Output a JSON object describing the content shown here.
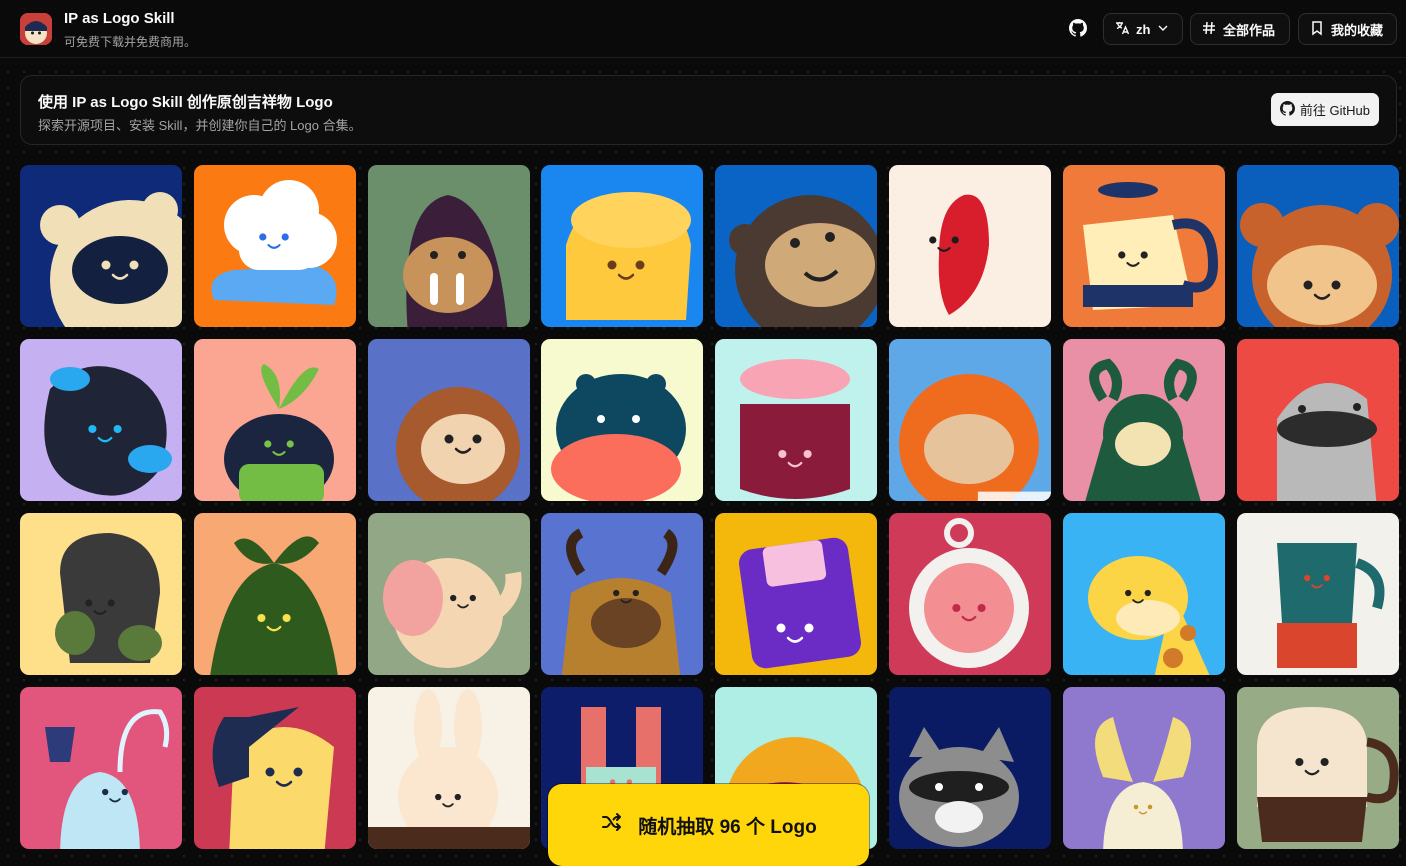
{
  "header": {
    "title": "IP as Logo Skill",
    "subtitle": "可免费下载并免费商用。",
    "language": "zh",
    "all_works": "全部作品",
    "favorites": "我的收藏"
  },
  "banner": {
    "title": "使用 IP as Logo Skill 创作原创吉祥物 Logo",
    "subtitle": "探索开源项目、安装 Skill，并创建你自己的 Logo 合集。",
    "github_button": "前往 GitHub"
  },
  "random_button": "随机抽取 96 个 Logo",
  "colors": {
    "accent": "#ffd60a",
    "background": "#0a0a0a"
  },
  "tiles": [
    {
      "bg": "#0f2a78",
      "fg": "#f1dfb7",
      "kind": "bear-mask"
    },
    {
      "bg": "#fb7b12",
      "fg": "#ffffff",
      "kind": "cloud"
    },
    {
      "bg": "#6a8f6a",
      "fg": "#3b1e3a",
      "kind": "walrus"
    },
    {
      "bg": "#1a87f1",
      "fg": "#ffc93e",
      "kind": "mooncake"
    },
    {
      "bg": "#0a64c6",
      "fg": "#4a3a31",
      "kind": "monkey"
    },
    {
      "bg": "#fbeee2",
      "fg": "#d81e2c",
      "kind": "pin"
    },
    {
      "bg": "#f07a3a",
      "fg": "#ffeeb8",
      "kind": "kettle"
    },
    {
      "bg": "#0a5fbd",
      "fg": "#c8622d",
      "kind": "monkey2"
    },
    {
      "bg": "#c5b0f2",
      "fg": "#1f2536",
      "kind": "blob"
    },
    {
      "bg": "#fba593",
      "fg": "#1b2540",
      "kind": "sprout"
    },
    {
      "bg": "#5971c7",
      "fg": "#a65a2e",
      "kind": "monkey3"
    },
    {
      "bg": "#f7f9cf",
      "fg": "#0e4860",
      "kind": "hippo"
    },
    {
      "bg": "#bff2ec",
      "fg": "#8b1b3b",
      "kind": "jar"
    },
    {
      "bg": "#5fa8e8",
      "fg": "#ef6c1f",
      "kind": "mushroom"
    },
    {
      "bg": "#e98fa6",
      "fg": "#1d5a3e",
      "kind": "goat"
    },
    {
      "bg": "#ee4a44",
      "fg": "#b9b9b9",
      "kind": "platypus"
    },
    {
      "bg": "#ffe08a",
      "fg": "#3b3a3b",
      "kind": "stone"
    },
    {
      "bg": "#f8a872",
      "fg": "#2f5a1e",
      "kind": "sprout2"
    },
    {
      "bg": "#92a785",
      "fg": "#f4d6b3",
      "kind": "elephant"
    },
    {
      "bg": "#5973d0",
      "fg": "#b7802e",
      "kind": "yak"
    },
    {
      "bg": "#f4b80d",
      "fg": "#6a2cc4",
      "kind": "floppy"
    },
    {
      "bg": "#cf3a58",
      "fg": "#f38e93",
      "kind": "lion"
    },
    {
      "bg": "#39b3f4",
      "fg": "#fcd546",
      "kind": "giraffe"
    },
    {
      "bg": "#f3f1ec",
      "fg": "#1f6a6c",
      "kind": "pot"
    },
    {
      "bg": "#e2557c",
      "fg": "#bfe6f5",
      "kind": "ghost-bell"
    },
    {
      "bg": "#cb3a52",
      "fg": "#fbd96b",
      "kind": "dog"
    },
    {
      "bg": "#f8f2e6",
      "fg": "#fbe7cf",
      "kind": "bunny"
    },
    {
      "bg": "#0d1d6a",
      "fg": "#e8706a",
      "kind": "magnet"
    },
    {
      "bg": "#aeeee5",
      "fg": "#f1a81e",
      "kind": "round"
    },
    {
      "bg": "#0b1b63",
      "fg": "#8d8d8d",
      "kind": "raccoon"
    },
    {
      "bg": "#8e79cf",
      "fg": "#f3dc7b",
      "kind": "horns"
    },
    {
      "bg": "#97ac86",
      "fg": "#f5e5cf",
      "kind": "mug"
    }
  ],
  "tile_hover_index": 13
}
